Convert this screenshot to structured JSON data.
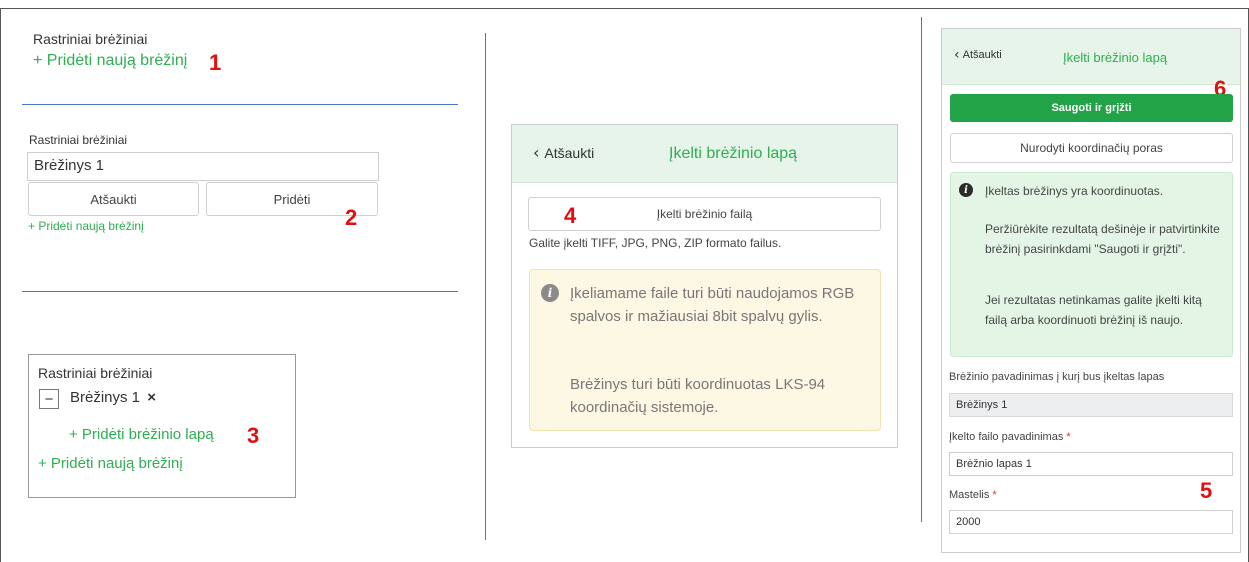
{
  "section1": {
    "title": "Rastriniai brėžiniai",
    "add_new_link": "+ Pridėti naują brėžinį",
    "marker": "1"
  },
  "section2": {
    "title": "Rastriniai brėžiniai",
    "input_value": "Brėžinys 1",
    "cancel_button": "Atšaukti",
    "add_button": "Pridėti",
    "add_new_link": "+ Pridėti naują brėžinį",
    "marker": "2"
  },
  "section3": {
    "title": "Rastriniai brėžiniai",
    "tree_toggle": "−",
    "drawing_name": "Brėžinys 1",
    "remove_glyph": "×",
    "add_sheet_link": "+ Pridėti brėžinio lapą",
    "add_new_link": "+ Pridėti naują brėžinį",
    "marker": "3"
  },
  "panel4": {
    "back_label": "Atšaukti",
    "title": "Įkelti brėžinio lapą",
    "upload_button": "Įkelti brėžinio failą",
    "formats_hint": "Galite įkelti TIFF, JPG, PNG, ZIP formato failus.",
    "warning_p1": "Įkeliamame faile turi būti naudojamos RGB spalvos ir mažiausiai 8bit spalvų gylis.",
    "warning_p2": "Brėžinys turi būti koordinuotas LKS-94 koordinačių sistemoje.",
    "marker": "4"
  },
  "panel5": {
    "back_label": "Atšaukti",
    "title": "Įkelti brėžinio lapą",
    "save_button": "Saugoti ir grįžti",
    "coords_button": "Nurodyti koordinačių poras",
    "info_p1": "Įkeltas brėžinys yra koordinuotas.",
    "info_p2": "Peržiūrėkite rezultatą dešinėje ir patvirtinkite brėžinį pasirinkdami \"Saugoti ir grįžti\".",
    "info_p3": "Jei rezultatas netinkamas galite įkelti kitą failą arba koordinuoti brėžinį iš naujo.",
    "drawing_name_label": "Brėžinio pavadinimas į kurį bus įkeltas lapas",
    "drawing_name_value": "Brėžinys 1",
    "file_name_label": "Įkelto failo pavadinimas",
    "file_name_value": "Brėžnio lapas 1",
    "scale_label": "Mastelis",
    "scale_value": "2000",
    "required_mark": "*",
    "marker5": "5",
    "marker6": "6"
  },
  "colors": {
    "green_link": "#2fae52",
    "save_button": "#23a347",
    "divider": "#4b74c2",
    "marker_red": "#e01010"
  },
  "icons": {
    "back": "chevron-left-icon",
    "info": "info-circle-icon",
    "remove": "close-icon",
    "collapse": "minus-icon"
  }
}
